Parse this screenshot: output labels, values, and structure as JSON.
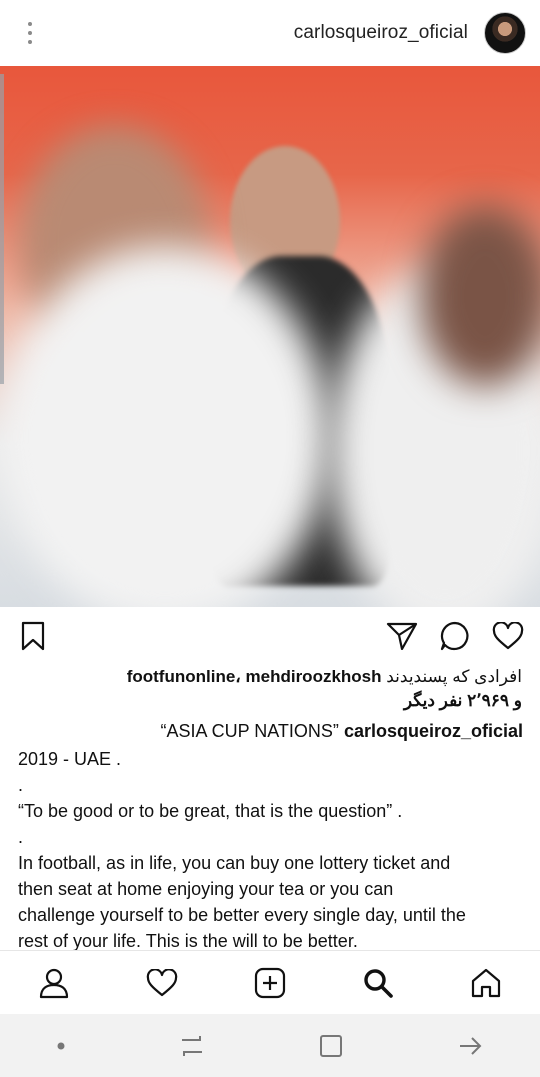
{
  "header": {
    "username": "carlosqueiroz_oficial"
  },
  "post": {
    "likes_line1_names": "footfunonline، mehdiroozkhosh",
    "likes_line1_prefix": "افرادی که پسندیدند",
    "likes_line2": "و ۲٬۹۶۹ نفر دیگر",
    "caption_user": "carlosqueiroz_oficial",
    "caption_title": "“ASIA CUP NATIONS”",
    "caption_lines": [
      "2019 - UAE .",
      ".",
      "“To be good or to be great, that is the question” .",
      ".",
      "In football, as in life, you can buy one lottery ticket and",
      "then seat at home enjoying your tea or you can",
      "challenge yourself to be better every single day, until the",
      "rest of your life. This is the will to be better."
    ]
  },
  "icons": {
    "menu": "kebab-icon",
    "save": "bookmark-icon",
    "share": "send-icon",
    "comment": "comment-icon",
    "like": "heart-icon",
    "nav": [
      "profile-icon",
      "heart-icon",
      "add-icon",
      "search-icon",
      "home-icon"
    ],
    "system": [
      "dot",
      "recents-icon",
      "square-icon",
      "back-icon"
    ]
  }
}
